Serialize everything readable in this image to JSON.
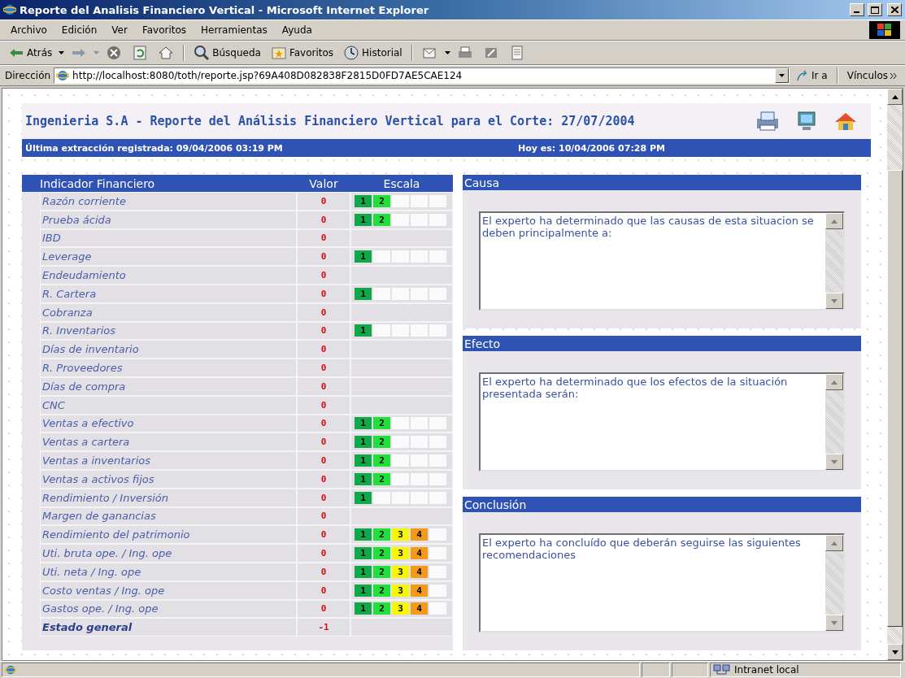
{
  "window": {
    "title": "Reporte del Analisis Financiero Vertical - Microsoft Internet Explorer"
  },
  "menu": [
    "Archivo",
    "Edición",
    "Ver",
    "Favoritos",
    "Herramientas",
    "Ayuda"
  ],
  "toolbar": [
    {
      "kind": "back",
      "label": "Atrás"
    },
    {
      "kind": "forward"
    },
    {
      "kind": "stop"
    },
    {
      "kind": "refresh"
    },
    {
      "kind": "home"
    },
    {
      "kind": "search",
      "label": "Búsqueda"
    },
    {
      "kind": "favorites",
      "label": "Favoritos"
    },
    {
      "kind": "history",
      "label": "Historial"
    },
    {
      "kind": "mail"
    },
    {
      "kind": "print"
    },
    {
      "kind": "edit"
    },
    {
      "kind": "discuss"
    }
  ],
  "address": {
    "label": "Dirección",
    "value": "http://localhost:8080/toth/reporte.jsp?69A408D082838F2815D0FD7AE5CAE124",
    "go": "Ir a",
    "links": "Vínculos"
  },
  "page": {
    "title": "Ingenieria S.A - Reporte del Análisis Financiero Vertical para el Corte: 27/07/2004",
    "banner": {
      "last_extraction": "Última extracción registrada: 09/04/2006 03:19 PM",
      "today": "Hoy es: 10/04/2006 07:28 PM"
    },
    "table": {
      "columns": [
        "Indicador Financiero",
        "Valor",
        "Escala"
      ],
      "rows": [
        {
          "name": "Razón corriente",
          "value": "0",
          "scale": [
            {
              "label": "1",
              "color": "#12a84a"
            },
            {
              "label": "2",
              "color": "#22e03c"
            },
            {
              "kind": "empty"
            },
            {
              "kind": "empty"
            },
            {
              "kind": "empty"
            }
          ]
        },
        {
          "name": "Prueba ácida",
          "value": "0",
          "scale": [
            {
              "label": "1",
              "color": "#12a84a"
            },
            {
              "label": "2",
              "color": "#22e03c"
            },
            {
              "kind": "empty"
            },
            {
              "kind": "empty"
            },
            {
              "kind": "empty"
            }
          ]
        },
        {
          "name": "IBD",
          "value": "0"
        },
        {
          "name": "Leverage",
          "value": "0",
          "scale": [
            {
              "label": "1",
              "color": "#12a84a"
            },
            {
              "kind": "empty"
            },
            {
              "kind": "empty"
            },
            {
              "kind": "empty"
            },
            {
              "kind": "empty"
            }
          ]
        },
        {
          "name": "Endeudamiento",
          "value": "0"
        },
        {
          "name": "R. Cartera",
          "value": "0",
          "scale": [
            {
              "label": "1",
              "color": "#12a84a"
            },
            {
              "kind": "empty"
            },
            {
              "kind": "empty"
            },
            {
              "kind": "empty"
            },
            {
              "kind": "empty"
            }
          ]
        },
        {
          "name": "Cobranza",
          "value": "0"
        },
        {
          "name": "R. Inventarios",
          "value": "0",
          "scale": [
            {
              "label": "1",
              "color": "#12a84a"
            },
            {
              "kind": "empty"
            },
            {
              "kind": "empty"
            },
            {
              "kind": "empty"
            },
            {
              "kind": "empty"
            }
          ]
        },
        {
          "name": "Días de inventario",
          "value": "0"
        },
        {
          "name": "R. Proveedores",
          "value": "0"
        },
        {
          "name": "Días de compra",
          "value": "0"
        },
        {
          "name": "CNC",
          "value": "0"
        },
        {
          "name": "Ventas a efectivo",
          "value": "0",
          "scale": [
            {
              "label": "1",
              "color": "#12a84a"
            },
            {
              "label": "2",
              "color": "#22e03c"
            },
            {
              "kind": "empty"
            },
            {
              "kind": "empty"
            },
            {
              "kind": "empty"
            }
          ]
        },
        {
          "name": "Ventas a cartera",
          "value": "0",
          "scale": [
            {
              "label": "1",
              "color": "#12a84a"
            },
            {
              "label": "2",
              "color": "#22e03c"
            },
            {
              "kind": "empty"
            },
            {
              "kind": "empty"
            },
            {
              "kind": "empty"
            }
          ]
        },
        {
          "name": "Ventas a inventarios",
          "value": "0",
          "scale": [
            {
              "label": "1",
              "color": "#12a84a"
            },
            {
              "label": "2",
              "color": "#22e03c"
            },
            {
              "kind": "empty"
            },
            {
              "kind": "empty"
            },
            {
              "kind": "empty"
            }
          ]
        },
        {
          "name": "Ventas a activos fijos",
          "value": "0",
          "scale": [
            {
              "label": "1",
              "color": "#12a84a"
            },
            {
              "label": "2",
              "color": "#22e03c"
            },
            {
              "kind": "empty"
            },
            {
              "kind": "empty"
            },
            {
              "kind": "empty"
            }
          ]
        },
        {
          "name": "Rendimiento / Inversión",
          "value": "0",
          "scale": [
            {
              "label": "1",
              "color": "#12a84a"
            },
            {
              "kind": "empty"
            },
            {
              "kind": "empty"
            },
            {
              "kind": "empty"
            },
            {
              "kind": "empty"
            }
          ]
        },
        {
          "name": "Margen de ganancias",
          "value": "0"
        },
        {
          "name": "Rendimiento del patrimonio",
          "value": "0",
          "scale": [
            {
              "label": "1",
              "color": "#12a84a"
            },
            {
              "label": "2",
              "color": "#22e03c"
            },
            {
              "label": "3",
              "color": "#f6f600"
            },
            {
              "label": "4",
              "color": "#f39a1a"
            },
            {
              "kind": "empty"
            }
          ]
        },
        {
          "name": "Uti. bruta ope. / Ing. ope",
          "value": "0",
          "scale": [
            {
              "label": "1",
              "color": "#12a84a"
            },
            {
              "label": "2",
              "color": "#22e03c"
            },
            {
              "label": "3",
              "color": "#f6f600"
            },
            {
              "label": "4",
              "color": "#f39a1a"
            },
            {
              "kind": "empty"
            }
          ]
        },
        {
          "name": "Uti. neta / Ing. ope",
          "value": "0",
          "scale": [
            {
              "label": "1",
              "color": "#12a84a"
            },
            {
              "label": "2",
              "color": "#22e03c"
            },
            {
              "label": "3",
              "color": "#f6f600"
            },
            {
              "label": "4",
              "color": "#f39a1a"
            },
            {
              "kind": "empty"
            }
          ]
        },
        {
          "name": "Costo ventas / Ing. ope",
          "value": "0",
          "scale": [
            {
              "label": "1",
              "color": "#12a84a"
            },
            {
              "label": "2",
              "color": "#22e03c"
            },
            {
              "label": "3",
              "color": "#f6f600"
            },
            {
              "label": "4",
              "color": "#f39a1a"
            },
            {
              "kind": "empty"
            }
          ]
        },
        {
          "name": "Gastos ope. / Ing. ope",
          "value": "0",
          "scale": [
            {
              "label": "1",
              "color": "#12a84a"
            },
            {
              "label": "2",
              "color": "#22e03c"
            },
            {
              "label": "3",
              "color": "#f6f600"
            },
            {
              "label": "4",
              "color": "#f39a1a"
            },
            {
              "kind": "empty"
            }
          ]
        },
        {
          "name": "Estado general",
          "value": "-1",
          "kind": "total"
        }
      ]
    },
    "panels": [
      {
        "title": "Causa",
        "text": "El experto ha determinado que las causas de esta situacion se deben principalmente a:"
      },
      {
        "title": "Efecto",
        "text": "El experto ha determinado que los efectos de la situación presentada serán:"
      },
      {
        "title": "Conclusión",
        "text": "El experto ha concluído que deberán seguirse las siguientes recomendaciones"
      }
    ]
  },
  "status_bar": {
    "zone": "Intranet local"
  }
}
